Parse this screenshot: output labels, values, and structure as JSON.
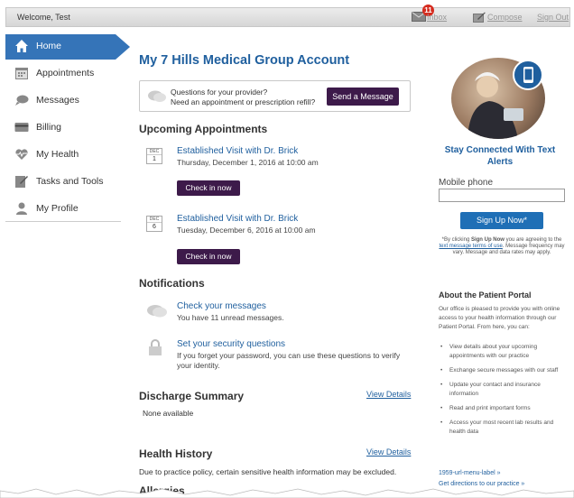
{
  "header": {
    "welcome": "Welcome, Test",
    "inbox_label": "Inbox",
    "inbox_count": "11",
    "compose_label": "Compose",
    "signout_label": "Sign Out"
  },
  "sidebar": {
    "items": [
      {
        "label": "Home",
        "icon": "home-icon"
      },
      {
        "label": "Appointments",
        "icon": "calendar-icon"
      },
      {
        "label": "Messages",
        "icon": "chat-bubble-icon"
      },
      {
        "label": "Billing",
        "icon": "credit-card-icon"
      },
      {
        "label": "My Health",
        "icon": "heartbeat-icon"
      },
      {
        "label": "Tasks and Tools",
        "icon": "tasks-icon"
      },
      {
        "label": "My Profile",
        "icon": "person-icon"
      }
    ]
  },
  "main": {
    "title": "My 7 Hills Medical Group Account",
    "provider_box": {
      "line1": "Questions for your provider?",
      "line2": "Need an appointment or prescription refill?",
      "button": "Send a Message"
    },
    "appointments_title": "Upcoming Appointments",
    "appointments": [
      {
        "month": "DEC",
        "day": "1",
        "title": "Established Visit with Dr. Brick",
        "when": "Thursday, December 1, 2016 at 10:00 am",
        "button": "Check in now"
      },
      {
        "month": "DEC",
        "day": "6",
        "title": "Established Visit with Dr. Brick",
        "when": "Tuesday, December 6, 2016 at 10:00 am",
        "button": "Check in now"
      }
    ],
    "notifications_title": "Notifications",
    "notifications": [
      {
        "title": "Check your messages",
        "text": "You have 11 unread messages."
      },
      {
        "title": "Set your security questions",
        "text": "If you forget your password, you can use these questions to verify your identity."
      }
    ],
    "discharge_title": "Discharge Summary",
    "discharge_view": "View Details",
    "discharge_text": "None available",
    "history_title": "Health History",
    "history_view": "View Details",
    "history_text": "Due to practice policy, certain sensitive health information may be excluded.",
    "allergies_title": "Allergies"
  },
  "right": {
    "stay_title": "Stay Connected With Text Alerts",
    "mobile_label": "Mobile phone",
    "mobile_value": "",
    "signup_button": "Sign Up Now*",
    "disclaimer_pre": "*By clicking ",
    "disclaimer_bold": "Sign Up Now",
    "disclaimer_mid": " you are agreeing to the ",
    "disclaimer_link": "text message terms of use",
    "disclaimer_post": ". Message frequency may vary. Message and data rates may apply.",
    "about_title": "About the Patient Portal",
    "about_intro": "Our office is pleased to provide you with online access to your health information through our Patient Portal. From here, you can:",
    "about_items": [
      "View details about your upcoming appointments with our practice",
      "Exchange secure messages with our staff",
      "Update your contact and insurance information",
      "Read and print important forms",
      "Access your most recent lab results and health data"
    ],
    "link1": "1959-url-menu-label »",
    "link2": "Get directions to our practice »"
  }
}
